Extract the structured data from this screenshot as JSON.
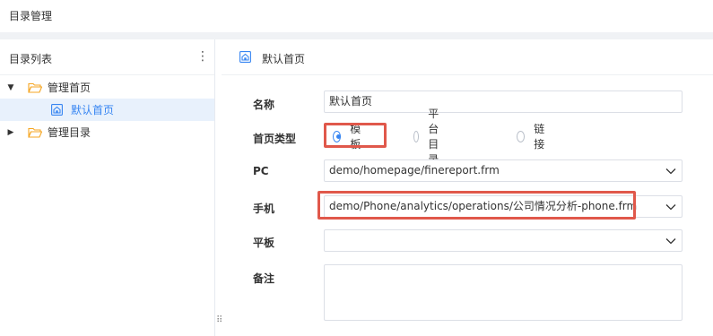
{
  "header": {
    "title": "目录管理"
  },
  "sidebar": {
    "title": "目录列表",
    "menu_icon": "more-vertical-icon",
    "items": [
      {
        "label": "管理首页",
        "icon": "folder-open-icon",
        "expanded": true
      },
      {
        "label": "默认首页",
        "icon": "home-page-icon",
        "selected": true
      },
      {
        "label": "管理目录",
        "icon": "folder-icon",
        "expanded": false
      }
    ]
  },
  "panel": {
    "title": "默认首页",
    "icon": "home-page-icon"
  },
  "form": {
    "name": {
      "label": "名称",
      "value": "默认首页"
    },
    "type": {
      "label": "首页类型",
      "options": [
        "模板",
        "平台目录",
        "链接"
      ],
      "selected": "模板"
    },
    "pc": {
      "label": "PC",
      "value": "demo/homepage/finereport.frm"
    },
    "mobile": {
      "label": "手机",
      "value": "demo/Phone/analytics/operations/公司情况分析-phone.frm"
    },
    "tablet": {
      "label": "平板",
      "value": ""
    },
    "note": {
      "label": "备注",
      "value": ""
    }
  },
  "colors": {
    "accent": "#3685f2",
    "highlight": "#e0584b",
    "folder": "#f5a623",
    "selected_bg": "#e8f1fc"
  }
}
